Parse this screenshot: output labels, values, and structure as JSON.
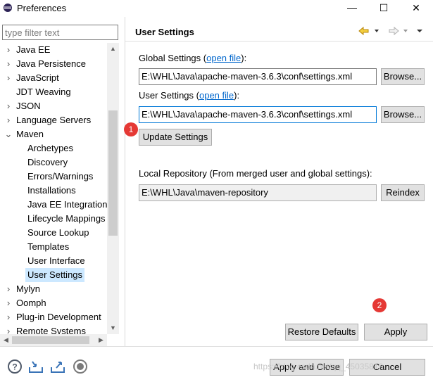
{
  "window": {
    "title": "Preferences",
    "minimize_glyph": "—",
    "maximize_glyph": "☐",
    "close_glyph": "✕"
  },
  "filter": {
    "placeholder": "type filter text"
  },
  "tree": {
    "items": [
      {
        "label": "Java EE",
        "arrow": "›"
      },
      {
        "label": "Java Persistence",
        "arrow": "›"
      },
      {
        "label": "JavaScript",
        "arrow": "›"
      },
      {
        "label": "JDT Weaving",
        "arrow": ""
      },
      {
        "label": "JSON",
        "arrow": "›"
      },
      {
        "label": "Language Servers",
        "arrow": "›"
      },
      {
        "label": "Maven",
        "arrow": "⌄"
      },
      {
        "label": "Archetypes",
        "arrow": ""
      },
      {
        "label": "Discovery",
        "arrow": ""
      },
      {
        "label": "Errors/Warnings",
        "arrow": ""
      },
      {
        "label": "Installations",
        "arrow": ""
      },
      {
        "label": "Java EE Integration",
        "arrow": ""
      },
      {
        "label": "Lifecycle Mappings",
        "arrow": ""
      },
      {
        "label": "Source Lookup",
        "arrow": ""
      },
      {
        "label": "Templates",
        "arrow": ""
      },
      {
        "label": "User Interface",
        "arrow": ""
      },
      {
        "label": "User Settings",
        "arrow": "",
        "selected": true
      },
      {
        "label": "Mylyn",
        "arrow": "›"
      },
      {
        "label": "Oomph",
        "arrow": "›"
      },
      {
        "label": "Plug-in Development",
        "arrow": "›"
      },
      {
        "label": "Remote Systems",
        "arrow": "›"
      }
    ]
  },
  "page": {
    "title": "User Settings",
    "global_settings_label": "Global Settings (",
    "global_settings_link": "open file",
    "global_settings_suffix": "):",
    "global_settings_value": "E:\\WHL\\Java\\apache-maven-3.6.3\\conf\\settings.xml",
    "user_settings_label": "User Settings (",
    "user_settings_link": "open file",
    "user_settings_suffix": "):",
    "user_settings_value": "E:\\WHL\\Java\\apache-maven-3.6.3\\conf\\settings.xml",
    "browse_label": "Browse...",
    "update_settings_label": "Update Settings",
    "local_repo_label": "Local Repository (From merged user and global settings):",
    "local_repo_value": "E:\\WHL\\Java\\maven-repository",
    "reindex_label": "Reindex",
    "restore_defaults_label": "Restore Defaults",
    "apply_label": "Apply"
  },
  "badges": {
    "one": "1",
    "two": "2"
  },
  "footer": {
    "apply_close_label": "Apply and Close",
    "cancel_label": "Cancel",
    "watermark": "https://blog.csdn.net/qq_45035810"
  },
  "colors": {
    "badge": "#e53935",
    "link": "#0066cc",
    "selection": "#cce8ff",
    "focus_border": "#0078d7"
  }
}
